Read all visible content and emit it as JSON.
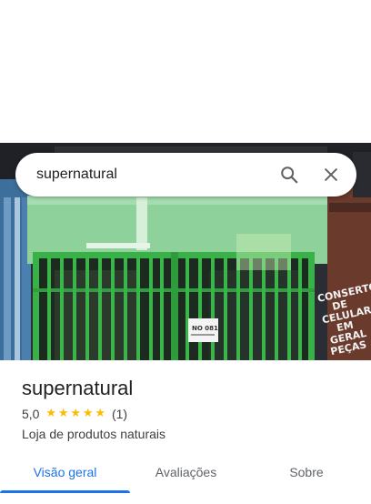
{
  "search": {
    "value": "supernatural",
    "search_icon": "search-icon",
    "close_icon": "close-icon"
  },
  "photo": {
    "storefront_sign_text": "CONSERTOS DE CELULARES EM GERAL PEÇAS",
    "door_notice": "NO 081"
  },
  "place": {
    "name": "supernatural",
    "rating": "5,0",
    "stars": 5,
    "star_glyph": "★",
    "review_count": "(1)",
    "category": "Loja de produtos naturais"
  },
  "tabs": [
    {
      "label": "Visão geral",
      "active": true
    },
    {
      "label": "Avaliações",
      "active": false
    },
    {
      "label": "Sobre",
      "active": false
    }
  ],
  "colors": {
    "accent": "#1a73e8",
    "star": "#fbbc04",
    "text_primary": "#202124",
    "text_secondary": "#5f6368"
  }
}
